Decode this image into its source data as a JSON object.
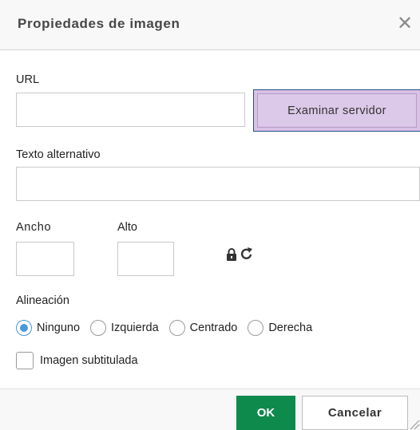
{
  "dialog": {
    "title": "Propiedades de imagen",
    "close_label": "✕"
  },
  "url": {
    "label": "URL",
    "value": "",
    "placeholder": "",
    "browse_label": "Examinar servidor"
  },
  "alt_text": {
    "label": "Texto alternativo",
    "value": "",
    "placeholder": ""
  },
  "width": {
    "label": "Ancho",
    "value": ""
  },
  "height": {
    "label": "Alto",
    "value": ""
  },
  "icons": {
    "lock": "lock-icon",
    "reset": "reset-size-icon"
  },
  "alignment": {
    "label": "Alineación",
    "options": [
      {
        "label": "Ninguno",
        "checked": true
      },
      {
        "label": "Izquierda",
        "checked": false
      },
      {
        "label": "Centrado",
        "checked": false
      },
      {
        "label": "Derecha",
        "checked": false
      }
    ]
  },
  "caption": {
    "label": "Imagen subtitulada",
    "checked": false
  },
  "footer": {
    "ok_label": "OK",
    "cancel_label": "Cancelar"
  },
  "colors": {
    "ok_button": "#0e8a4c",
    "browse_button": "#d9c1e6",
    "radio_checked": "#4a9ad8"
  }
}
